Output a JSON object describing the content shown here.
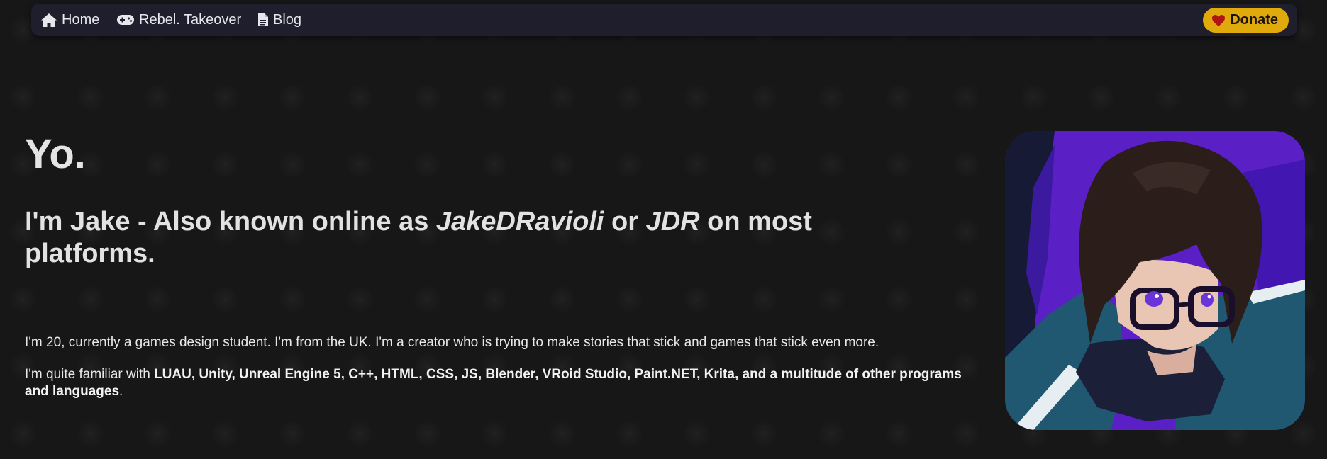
{
  "nav": {
    "home_label": "Home",
    "home_icon": "home-icon",
    "rebel_label": "Rebel. Takeover",
    "rebel_icon": "gamepad-icon",
    "blog_label": "Blog",
    "blog_icon": "document-icon",
    "donate_label": "Donate",
    "donate_icon": "heart-icon"
  },
  "hero": {
    "title": "Yo.",
    "sub_prefix": "I'm Jake - Also known online as ",
    "alias1": "JakeDRavioli",
    "sub_mid": " or ",
    "alias2": "JDR",
    "sub_suffix": " on most platforms."
  },
  "about": {
    "para1": "I'm 20, currently a games design student. I'm from the UK. I'm a creator who is trying to make stories that stick and games that stick even more.",
    "para2_prefix": "I'm quite familiar with ",
    "skills": "LUAU, Unity, Unreal Engine 5, C++, HTML, CSS, JS, Blender, VRoid Studio, Paint.NET, Krita, and a multitude of other programs and languages",
    "para2_suffix": "."
  },
  "colors": {
    "background": "#171717",
    "navbar": "#1f1e2c",
    "donate": "#e0a90c",
    "heart": "#b01515"
  }
}
